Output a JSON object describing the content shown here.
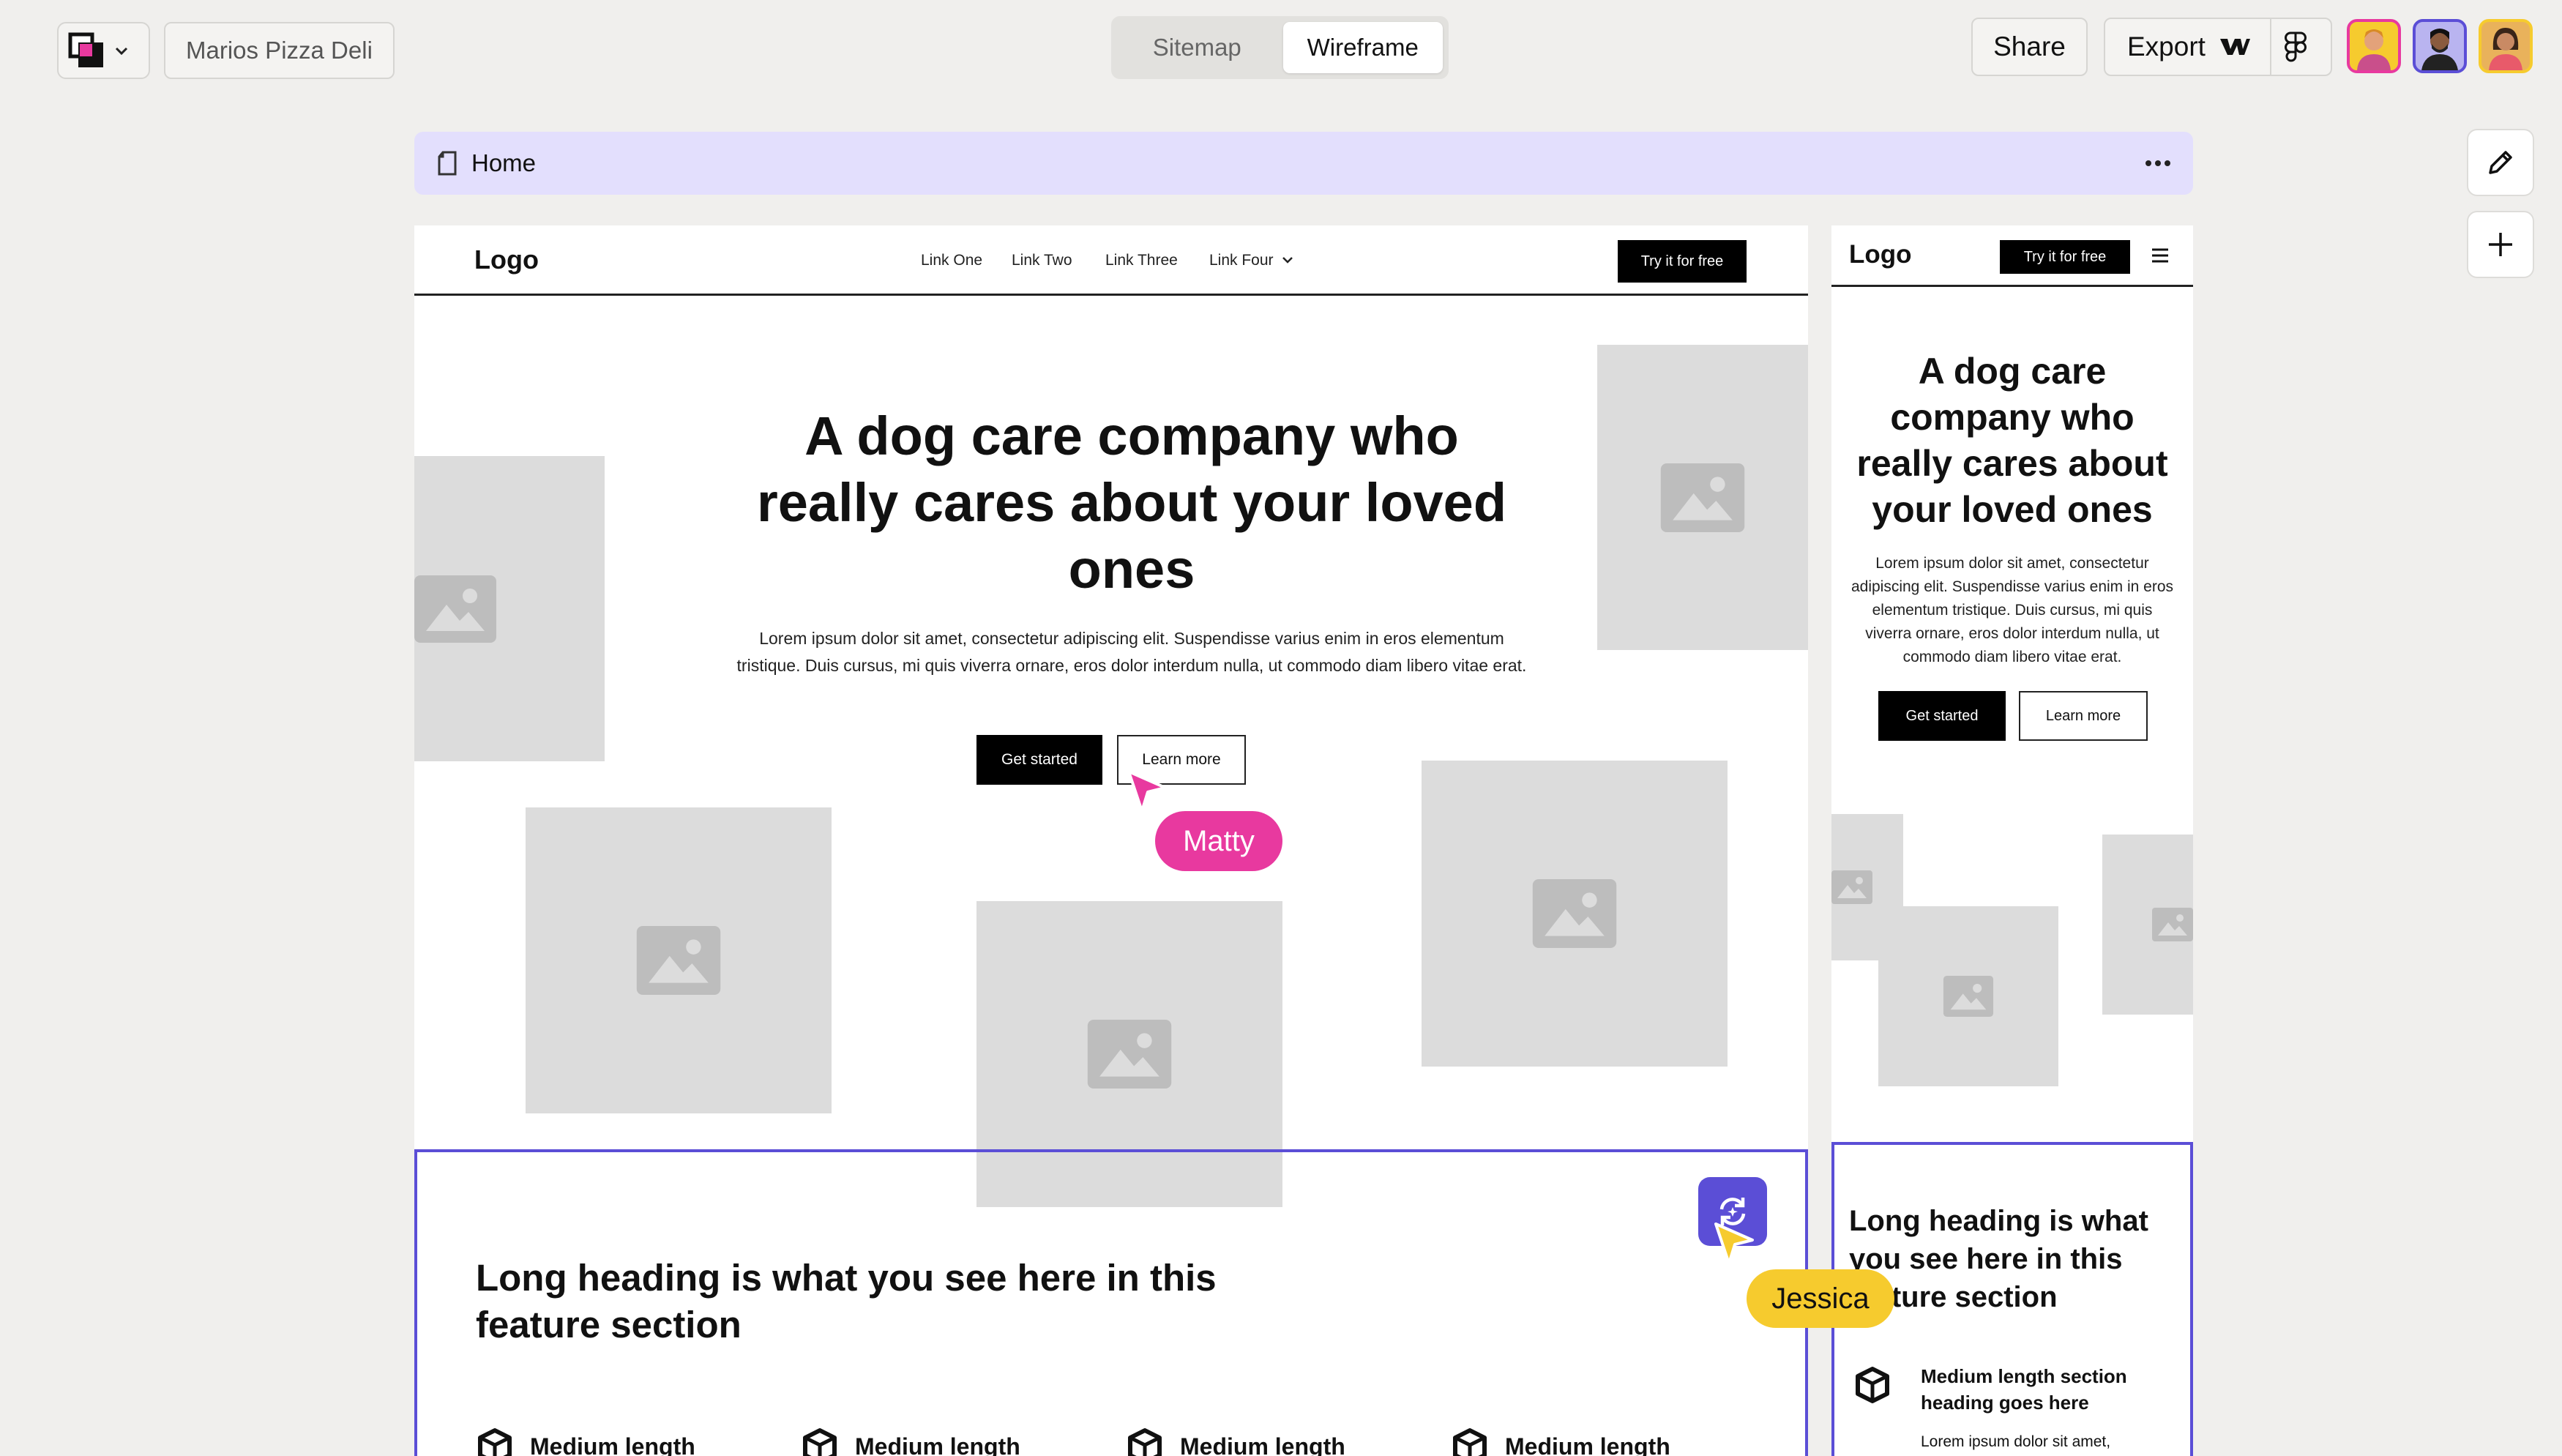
{
  "topbar": {
    "project_name": "Marios Pizza Deli",
    "views": [
      "Sitemap",
      "Wireframe"
    ],
    "active_view": "Wireframe",
    "share_label": "Share",
    "export_label": "Export"
  },
  "page_bar": {
    "title": "Home"
  },
  "desktop": {
    "logo": "Logo",
    "nav_links": [
      "Link One",
      "Link Two",
      "Link Three",
      "Link Four"
    ],
    "nav_cta": "Try it for free",
    "hero_heading": "A dog care company who really cares about your loved ones",
    "hero_text": "Lorem ipsum dolor sit amet, consectetur adipiscing elit. Suspendisse varius enim in eros elementum tristique. Duis cursus, mi quis viverra ornare, eros dolor interdum nulla, ut commodo diam libero vitae erat.",
    "primary_button": "Get started",
    "secondary_button": "Learn more",
    "feature_heading": "Long heading is what you see here in this feature section",
    "feature_items": [
      "Medium length",
      "Medium length",
      "Medium length",
      "Medium length"
    ]
  },
  "mobile": {
    "logo": "Logo",
    "nav_cta": "Try it for free",
    "hero_heading": "A dog care company who really cares about your loved ones",
    "hero_text": "Lorem ipsum dolor sit amet, consectetur adipiscing elit. Suspendisse varius enim in eros elementum tristique. Duis cursus, mi quis viverra ornare, eros dolor interdum nulla, ut commodo diam libero vitae erat.",
    "primary_button": "Get started",
    "secondary_button": "Learn more",
    "feature_heading": "Long heading is what you see here in this feature section",
    "feature_item_heading": "Medium length section heading goes here",
    "feature_item_text": "Lorem ipsum dolor sit amet,"
  },
  "cursors": {
    "matty": {
      "name": "Matty",
      "color": "#e8399f"
    },
    "jessica": {
      "name": "Jessica",
      "color": "#f6cb2e"
    }
  },
  "colors": {
    "accent": "#5b4ed6",
    "page_bar": "#e3dffd",
    "canvas": "#f0efed"
  }
}
